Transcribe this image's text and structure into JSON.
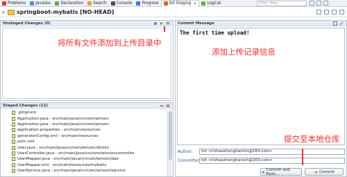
{
  "tabs": [
    {
      "label": "Problems",
      "color": "#d33b2b"
    },
    {
      "label": "Javadoc",
      "color": "#5b8fd1"
    },
    {
      "label": "Declaration",
      "color": "#6aa84f"
    },
    {
      "label": "Search",
      "color": "#e0a030"
    },
    {
      "label": "Console",
      "color": "#4a4a4a"
    },
    {
      "label": "Progress",
      "color": "#3c78d8"
    },
    {
      "label": "Git Staging",
      "color": "#e06030",
      "active": true
    },
    {
      "label": "LogCat",
      "color": "#6aa84f"
    }
  ],
  "filter_placeholder": "Filter files",
  "title": "springboot-mybatis [NO-HEAD]",
  "unstaged": {
    "header": "Unstaged Changes (0)",
    "annotation": "将所有文件添加到上传目录中"
  },
  "staged": {
    "header": "Staged Changes (12)",
    "items": [
      ".gitignore",
      "Application.java - src/main/java/cn/com/winson",
      "Application.java - src/main/java/cn/com/winson",
      "application.properties - src/main/resources",
      "generatorConfig.xml - src/main/resources",
      "pom.xml",
      "User.java - src/main/java/cn/com/winson/domin",
      "UserController.java - src/main/java/cn/com/winson/controller",
      "UserMapper.java - src/main/java/cn/com/winson/dao",
      "UserMapper.xml - src/main/resources/mybatis",
      "UserService.java - src/main/java/cn/com/winson/service"
    ]
  },
  "commit": {
    "header": "Commit Message",
    "message": "The first time upload!",
    "annotation_message": "添加上传记录信息",
    "annotation_commit": "提交至本地仓库",
    "author_label": "Author:",
    "author_value": "lvh <rizhaozhongtianlvh@163.com>",
    "committer_label": "Committer:",
    "committer_value": "lvh <rizhaozhongtianlvh@163.com>",
    "commit_push_label": "Commit and Push...",
    "commit_label": "Commit"
  },
  "colors": {
    "annotation": "#ff2b2b",
    "accent": "#2f5d9a"
  }
}
